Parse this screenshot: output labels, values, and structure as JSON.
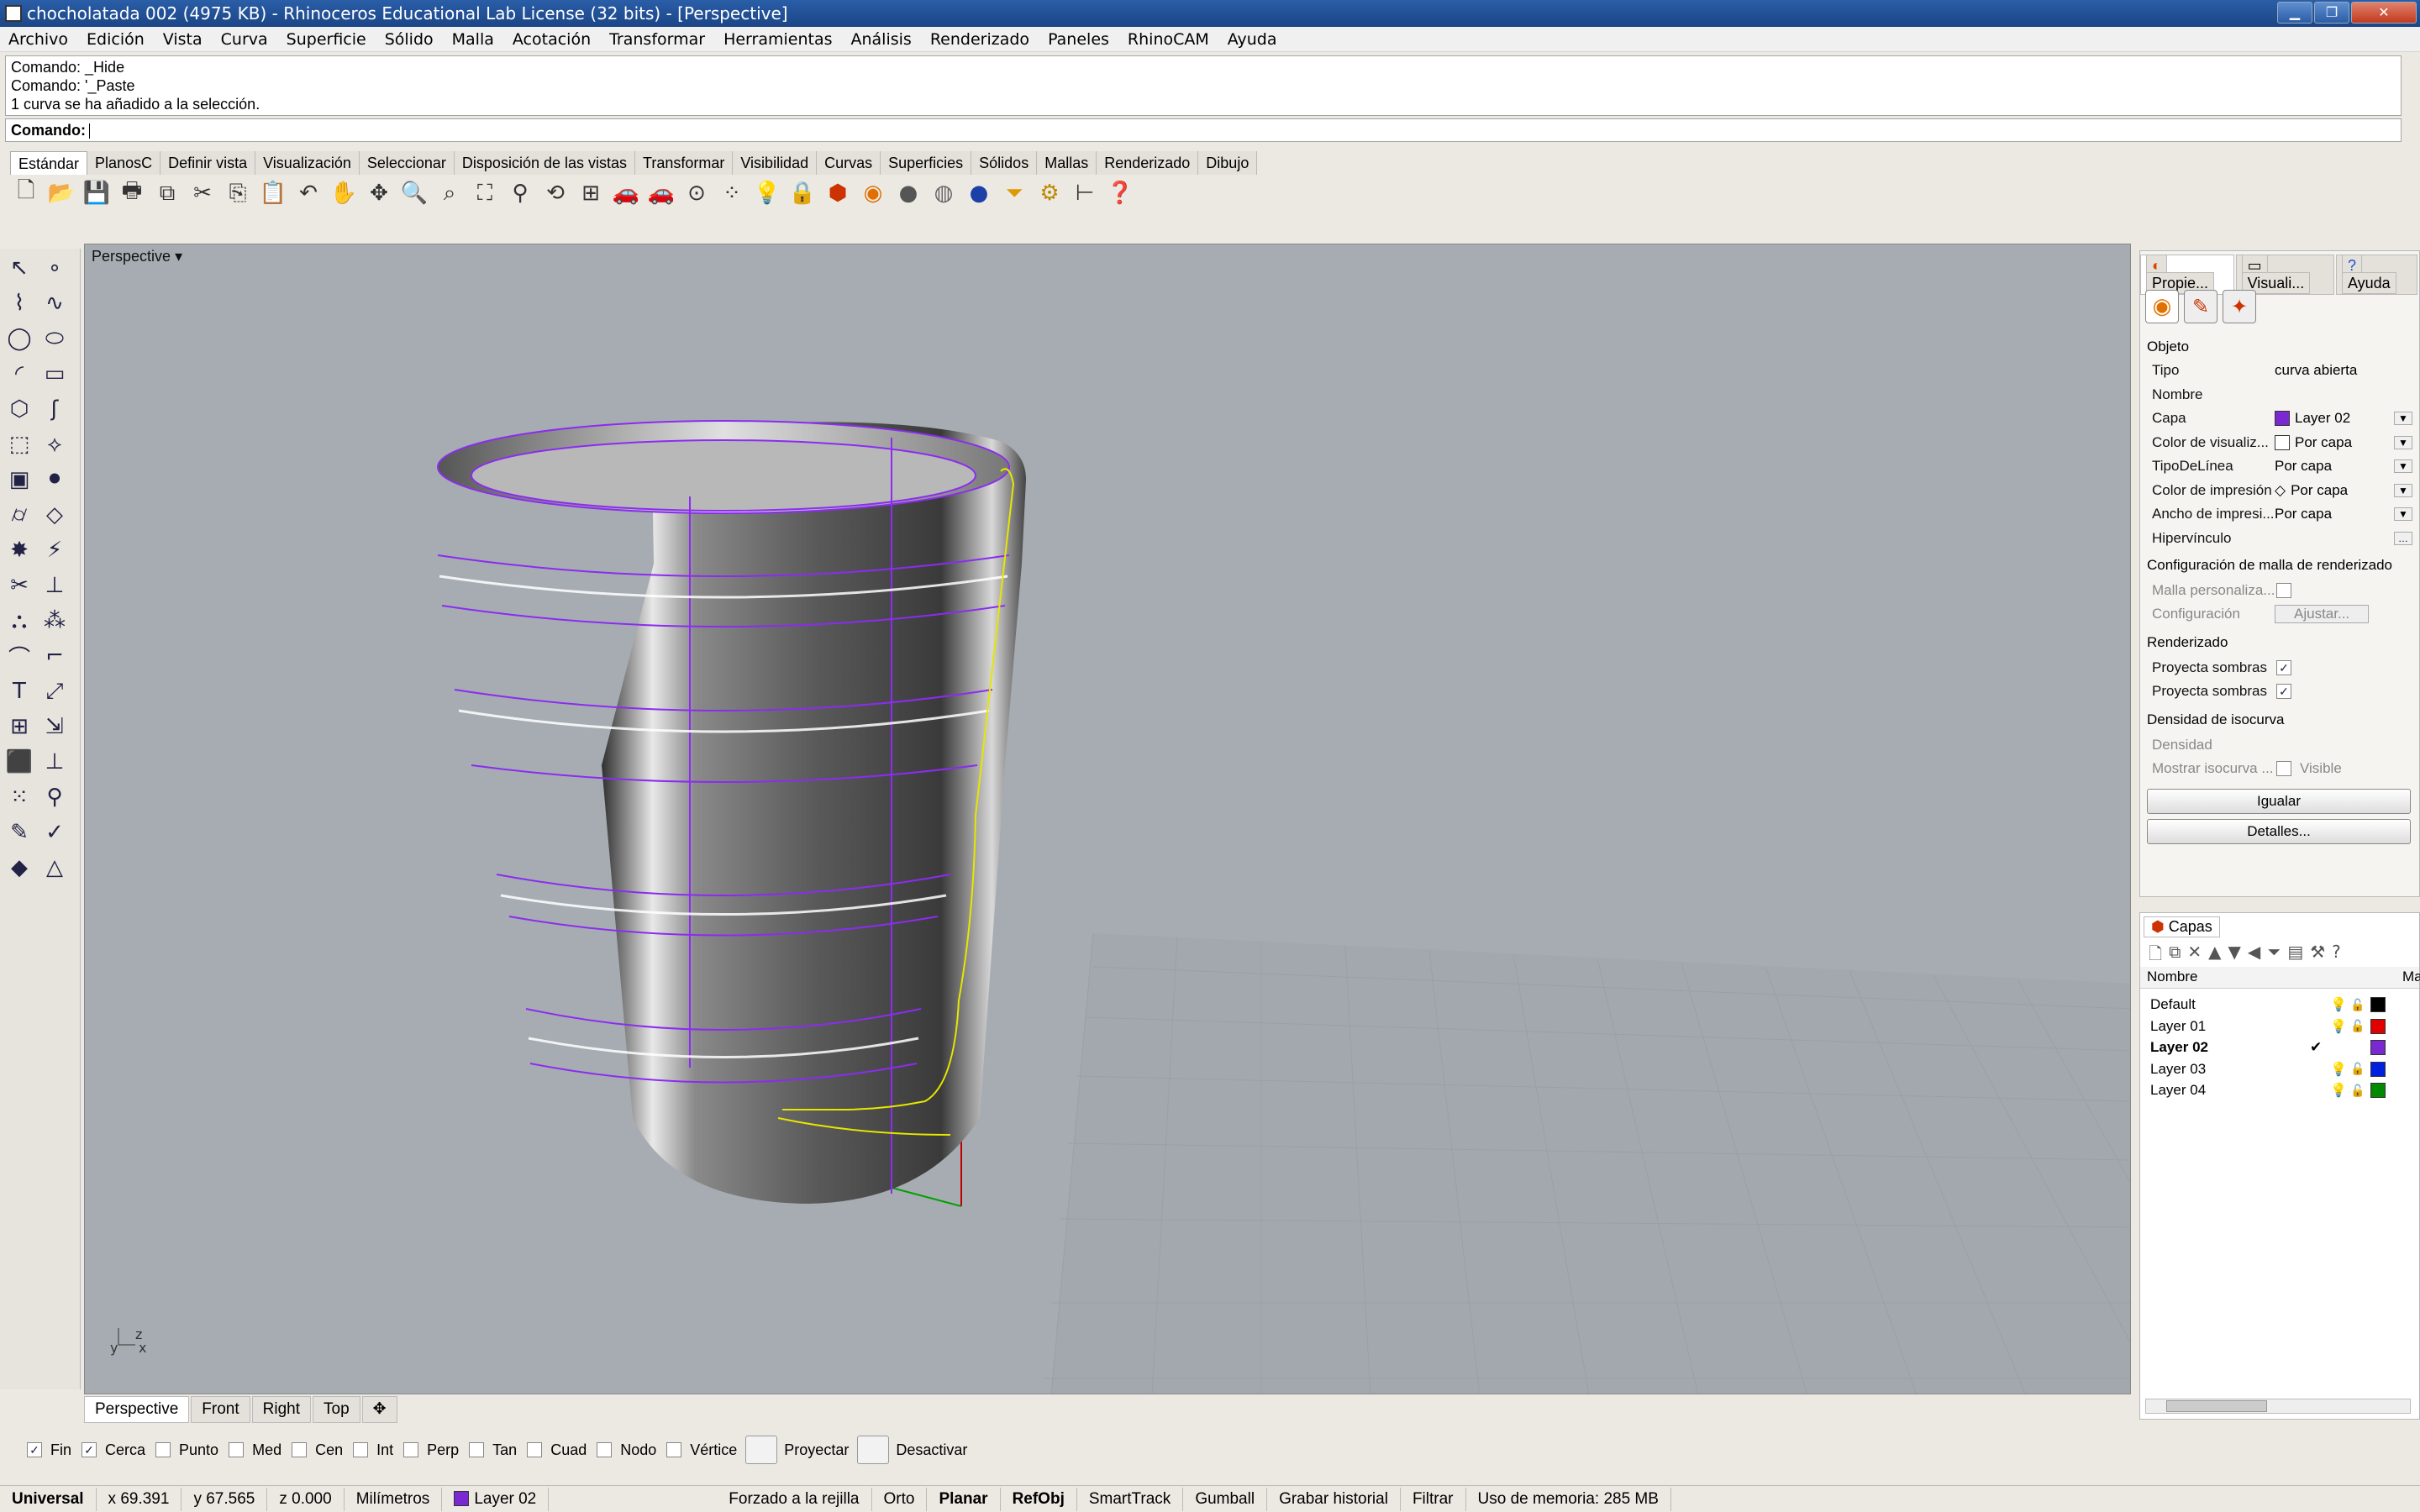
{
  "window": {
    "title": "chocholatada 002 (4975 KB) - Rhinoceros Educational Lab License (32 bits) - [Perspective]"
  },
  "menu": [
    "Archivo",
    "Edición",
    "Vista",
    "Curva",
    "Superficie",
    "Sólido",
    "Malla",
    "Acotación",
    "Transformar",
    "Herramientas",
    "Análisis",
    "Renderizado",
    "Paneles",
    "RhinoCAM",
    "Ayuda"
  ],
  "command": {
    "history": [
      "Comando: _Hide",
      "Comando: '_Paste",
      "1 curva se ha añadido a la selección."
    ],
    "prompt": "Comando:"
  },
  "toolbar_tabs": [
    "Estándar",
    "PlanosC",
    "Definir vista",
    "Visualización",
    "Seleccionar",
    "Disposición de las vistas",
    "Transformar",
    "Visibilidad",
    "Curvas",
    "Superficies",
    "Sólidos",
    "Mallas",
    "Renderizado",
    "Dibujo"
  ],
  "viewport": {
    "label": "Perspective",
    "axis_x": "x",
    "axis_y": "y",
    "axis_z": "z"
  },
  "view_tabs": [
    "Perspective",
    "Front",
    "Right",
    "Top"
  ],
  "osnaps": [
    {
      "label": "Fin",
      "checked": true
    },
    {
      "label": "Cerca",
      "checked": true
    },
    {
      "label": "Punto",
      "checked": false
    },
    {
      "label": "Med",
      "checked": false
    },
    {
      "label": "Cen",
      "checked": false
    },
    {
      "label": "Int",
      "checked": false
    },
    {
      "label": "Perp",
      "checked": false
    },
    {
      "label": "Tan",
      "checked": false
    },
    {
      "label": "Cuad",
      "checked": false
    },
    {
      "label": "Nodo",
      "checked": false
    },
    {
      "label": "Vértice",
      "checked": false
    }
  ],
  "osnap_buttons": [
    "Proyectar",
    "Desactivar"
  ],
  "status": {
    "cplane": "Universal",
    "x": "x 69.391",
    "y": "y 67.565",
    "z": "z 0.000",
    "units": "Milímetros",
    "layer": "Layer 02",
    "grid_snap": "Forzado a la rejilla",
    "ortho": "Orto",
    "planar": "Planar",
    "osnap": "RefObj",
    "smarttrack": "SmartTrack",
    "gumball": "Gumball",
    "history": "Grabar historial",
    "filter": "Filtrar",
    "memory": "Uso de memoria: 285 MB"
  },
  "props_panel": {
    "tabs": [
      "Propie...",
      "Visuali...",
      "Ayuda"
    ],
    "section_object": "Objeto",
    "rows": [
      {
        "k": "Tipo",
        "v": "curva abierta"
      },
      {
        "k": "Nombre",
        "v": ""
      },
      {
        "k": "Capa",
        "v": "Layer 02"
      },
      {
        "k": "Color de visualiz...",
        "v": "Por capa"
      },
      {
        "k": "TipoDeLínea",
        "v": "Por capa"
      },
      {
        "k": "Color de impresión",
        "v": "Por capa"
      },
      {
        "k": "Ancho de impresi...",
        "v": "Por capa"
      },
      {
        "k": "Hipervínculo",
        "v": ""
      }
    ],
    "section_mesh": "Configuración de malla de renderizado",
    "mesh_custom": "Malla personaliza...",
    "mesh_config": "Configuración",
    "mesh_adjust": "Ajustar...",
    "section_render": "Renderizado",
    "cast_shadows": "Proyecta sombras",
    "receive_shadows": "Proyecta sombras",
    "section_iso": "Densidad de isocurva",
    "density": "Densidad",
    "show_iso": "Mostrar isocurva ...",
    "visible": "Visible",
    "match_btn": "Igualar",
    "details_btn": "Detalles..."
  },
  "layers_panel": {
    "title": "Capas",
    "col_name": "Nombre",
    "col_material": "Ma",
    "layers": [
      {
        "name": "Default",
        "color": "#000000",
        "current": false
      },
      {
        "name": "Layer 01",
        "color": "#e00000",
        "current": false
      },
      {
        "name": "Layer 02",
        "color": "#7a28d0",
        "current": true
      },
      {
        "name": "Layer 03",
        "color": "#0020e0",
        "current": false
      },
      {
        "name": "Layer 04",
        "color": "#008a00",
        "current": false
      }
    ]
  },
  "colors": {
    "curve_purple": "#8b2cf0",
    "curve_yellow": "#e6e600",
    "axis_red": "#c00000",
    "axis_green": "#00a000"
  }
}
